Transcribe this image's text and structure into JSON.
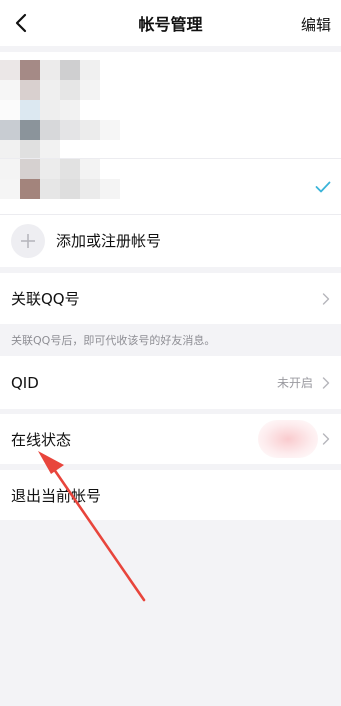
{
  "header": {
    "title": "帐号管理",
    "edit_label": "编辑"
  },
  "accounts": {
    "add_label": "添加或注册帐号"
  },
  "link_qq": {
    "label": "关联QQ号",
    "hint": "关联QQ号后，即可代收该号的好友消息。"
  },
  "qid": {
    "label": "QID",
    "value": "未开启"
  },
  "online_status": {
    "label": "在线状态"
  },
  "logout": {
    "label": "退出当前帐号"
  },
  "colors": {
    "accent": "#3bb4d9",
    "annotation_arrow": "#e8453c"
  }
}
